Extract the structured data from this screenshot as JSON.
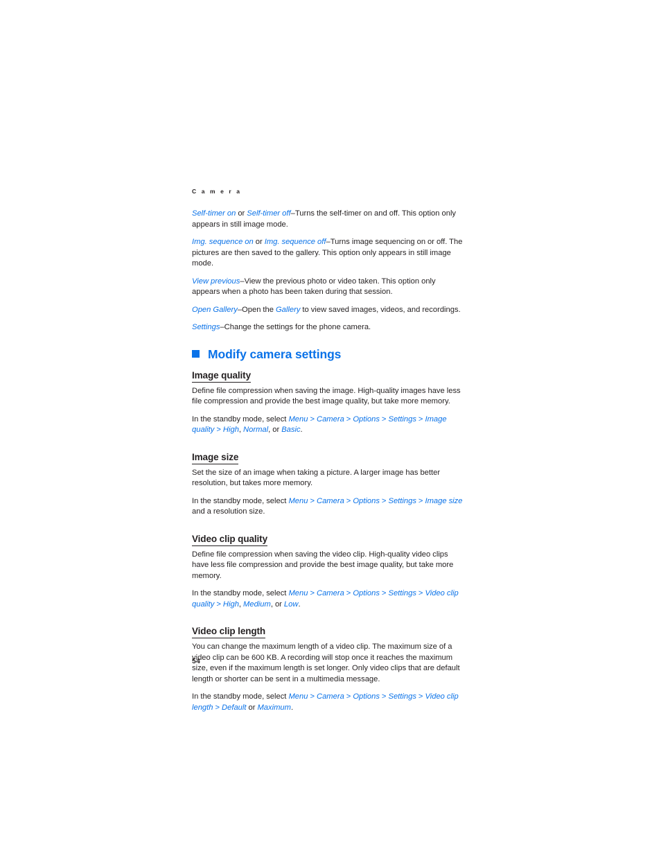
{
  "page": {
    "running_head": "C a m e r a",
    "folio": "54",
    "accent_blue": "#0a72e8",
    "text_color": "#231f20"
  },
  "intro_items": [
    {
      "terms": [
        "Self-timer on",
        "Self-timer off"
      ],
      "joiner": " or ",
      "dash": "–",
      "description": "Turns the self-timer on and off. This option only appears in still image mode."
    },
    {
      "terms": [
        "Img. sequence on",
        "Img. sequence off"
      ],
      "joiner": " or ",
      "dash": "–",
      "description": "Turns image sequencing on or off. The pictures are then saved to the gallery. This option only appears in still image mode."
    },
    {
      "terms": [
        "View previous"
      ],
      "joiner": "",
      "dash": "–",
      "description": "View the previous photo or video taken. This option only appears when a photo has been taken during that session."
    },
    {
      "terms": [
        "Open Gallery"
      ],
      "joiner": "",
      "dash": "–",
      "description_before": "Open the ",
      "inline_term": "Gallery",
      "description_after": " to view saved images, videos, and recordings."
    },
    {
      "terms": [
        "Settings"
      ],
      "joiner": "",
      "dash": "–",
      "description": "Change the settings for the phone camera."
    }
  ],
  "heading": {
    "bullet": "square-bullet",
    "title": "Modify camera settings"
  },
  "sections": [
    {
      "id": "image-quality",
      "title": "Image quality",
      "body": "Define file compression when saving the image. High-quality images have less file compression and provide the best image quality, but take more memory.",
      "path_intro": "In the standby mode, select ",
      "path": [
        "Menu",
        "Camera",
        "Options",
        "Settings",
        "Image quality"
      ],
      "path_separator": " > ",
      "options_lead": " > ",
      "options": [
        "High",
        "Normal",
        "Basic"
      ],
      "options_joiner": ", ",
      "options_last_joiner": ", or ",
      "path_tail": ".",
      "tail_plain": ""
    },
    {
      "id": "image-size",
      "title": "Image size",
      "body": "Set the size of an image when taking a picture. A larger image has better resolution, but takes more memory.",
      "path_intro": "In the standby mode, select ",
      "path": [
        "Menu",
        "Camera",
        "Options",
        "Settings",
        "Image size"
      ],
      "path_separator": " > ",
      "options_lead": "",
      "options": [],
      "options_joiner": "",
      "options_last_joiner": "",
      "path_tail": "",
      "tail_plain": " and a resolution size."
    },
    {
      "id": "video-clip-quality",
      "title": "Video clip quality",
      "body": "Define file compression when saving the video clip. High-quality video clips have less file compression and provide the best image quality, but take more memory.",
      "path_intro": "In the standby mode, select ",
      "path": [
        "Menu",
        "Camera",
        "Options",
        "Settings",
        "Video clip quality"
      ],
      "path_separator": " > ",
      "options_lead": " > ",
      "options": [
        "High",
        "Medium",
        "Low"
      ],
      "options_joiner": ", ",
      "options_last_joiner": ", or ",
      "path_tail": ".",
      "tail_plain": ""
    },
    {
      "id": "video-clip-length",
      "title": "Video clip length",
      "body": "You can change the maximum length of a video clip. The maximum size of a video clip can be 600 KB. A recording will stop once it reaches the maximum size, even if the maximum length is set longer. Only video clips that are default length or shorter can be sent in a multimedia message.",
      "path_intro": "In the standby mode, select ",
      "path": [
        "Menu",
        "Camera",
        "Options",
        "Settings",
        "Video clip length"
      ],
      "path_separator": " > ",
      "options_lead": " > ",
      "options": [
        "Default",
        "Maximum"
      ],
      "options_joiner": " or ",
      "options_last_joiner": " or ",
      "path_tail": ".",
      "tail_plain": ""
    }
  ]
}
